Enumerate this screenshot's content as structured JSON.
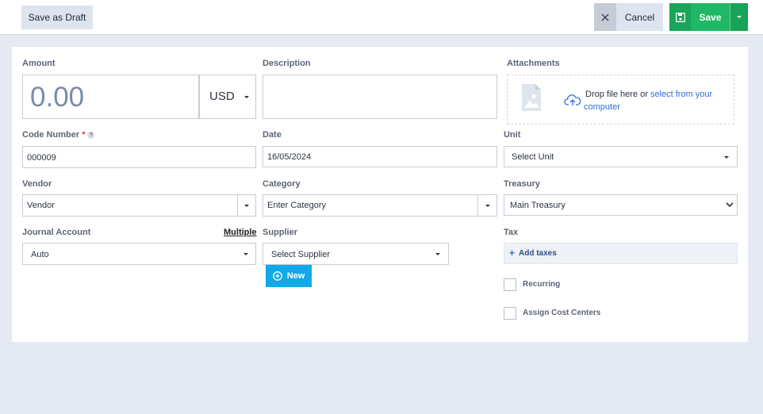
{
  "toolbar": {
    "draft_label": "Save as Draft",
    "cancel_label": "Cancel",
    "save_label": "Save"
  },
  "form": {
    "amount": {
      "label": "Amount",
      "value": "0.00",
      "currency": "USD"
    },
    "description": {
      "label": "Description",
      "value": ""
    },
    "attachments": {
      "label": "Attachments",
      "drop_text": "Drop file here or ",
      "select_link": "select from your",
      "select_link_2": "computer"
    },
    "code_number": {
      "label": "Code Number",
      "required_mark": "*",
      "help_mark": "?",
      "value": "000009"
    },
    "date": {
      "label": "Date",
      "value": "16/05/2024"
    },
    "unit": {
      "label": "Unit",
      "value": "Select Unit"
    },
    "vendor": {
      "label": "Vendor",
      "value": "Vendor"
    },
    "category": {
      "label": "Category",
      "value": "Enter Category"
    },
    "treasury": {
      "label": "Treasury",
      "value": "Main Treasury"
    },
    "journal_account": {
      "label": "Journal Account",
      "link": "Multiple",
      "value": "Auto"
    },
    "supplier": {
      "label": "Supplier",
      "value": "Select Supplier",
      "new_button": "New"
    },
    "tax": {
      "label": "Tax",
      "add_label": "Add taxes"
    },
    "recurring": {
      "label": "Recurring"
    },
    "cost_centers": {
      "label": "Assign Cost Centers"
    }
  },
  "colors": {
    "save_green": "#1fb864",
    "link_blue": "#2f6fd6",
    "new_blue": "#11a9e8"
  }
}
